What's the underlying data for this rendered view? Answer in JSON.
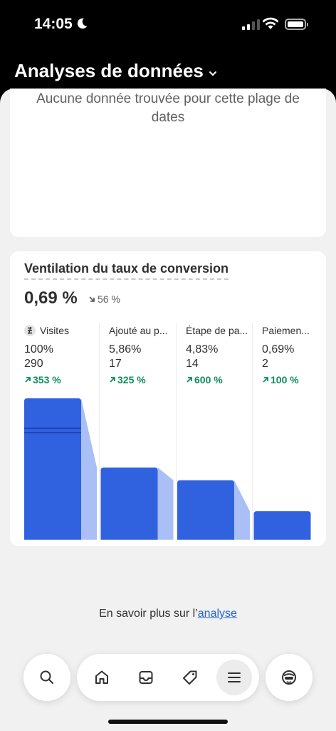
{
  "status_bar": {
    "time": "14:05"
  },
  "header": {
    "title": "Analyses de données"
  },
  "empty_card": {
    "message": "Aucune donnée trouvée pour cette plage de dates"
  },
  "conversion": {
    "title": "Ventilation du taux de conversion",
    "value": "0,69 %",
    "change": "56 %",
    "change_direction": "down",
    "columns": [
      {
        "label": "Visites",
        "percent": "100%",
        "count": "290",
        "change": "353 %"
      },
      {
        "label": "Ajouté au p...",
        "percent": "5,86%",
        "count": "17",
        "change": "325 %"
      },
      {
        "label": "Étape de pa...",
        "percent": "4,83%",
        "count": "14",
        "change": "600 %"
      },
      {
        "label": "Paiemen...",
        "percent": "0,69%",
        "count": "2",
        "change": "100 %"
      }
    ]
  },
  "chart_data": {
    "type": "bar",
    "categories": [
      "Visites",
      "Ajouté au p...",
      "Étape de pa...",
      "Paiemen..."
    ],
    "values": [
      290,
      17,
      14,
      2
    ],
    "percentages": [
      100,
      5.86,
      4.83,
      0.69
    ],
    "note": "truncated y-axis: first bar shown with break marks",
    "colors": {
      "bar": "#3062e0",
      "connector": "#a9bff5"
    }
  },
  "footer": {
    "learn_more_prefix": "En savoir plus sur l’",
    "learn_more_link": "analyse"
  },
  "nav": {
    "left": "search-icon",
    "items": [
      "home-icon",
      "orders-icon",
      "products-tag-icon",
      "menu-icon"
    ],
    "active": "menu-icon",
    "right": "sidekick-icon"
  },
  "colors": {
    "accent": "#2563d8",
    "positive": "#0c8f5a",
    "bar": "#3062e0"
  }
}
